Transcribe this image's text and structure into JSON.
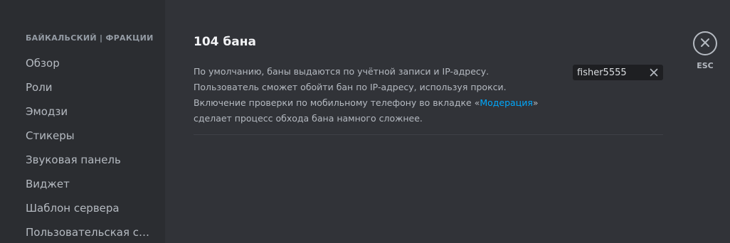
{
  "sidebar": {
    "header": "БАЙКАЛЬСКИЙ | ФРАКЦИИ",
    "items": [
      {
        "label": "Обзор"
      },
      {
        "label": "Роли"
      },
      {
        "label": "Эмодзи"
      },
      {
        "label": "Стикеры"
      },
      {
        "label": "Звуковая панель"
      },
      {
        "label": "Виджет"
      },
      {
        "label": "Шаблон сервера"
      },
      {
        "label": "Пользовательская сс..."
      }
    ]
  },
  "main": {
    "title": "104 бана",
    "description": {
      "before_link": "По умолчанию, баны выдаются по учётной записи и IP-адресу. Пользователь сможет обойти бан по IP-адресу, используя прокси. Включение проверки по мобильному телефону во вкладке «",
      "link": "Модерация",
      "after_link": "» сделает процесс обхода бана намного сложнее."
    },
    "search": {
      "value": "fisher5555",
      "placeholder": ""
    }
  },
  "close": {
    "label": "ESC"
  },
  "icons": {
    "close": "close-icon",
    "clear": "clear-search-icon"
  },
  "colors": {
    "sidebar_bg": "#2b2d31",
    "main_bg": "#313338",
    "link": "#00a8fc",
    "input_bg": "#1e1f22"
  }
}
